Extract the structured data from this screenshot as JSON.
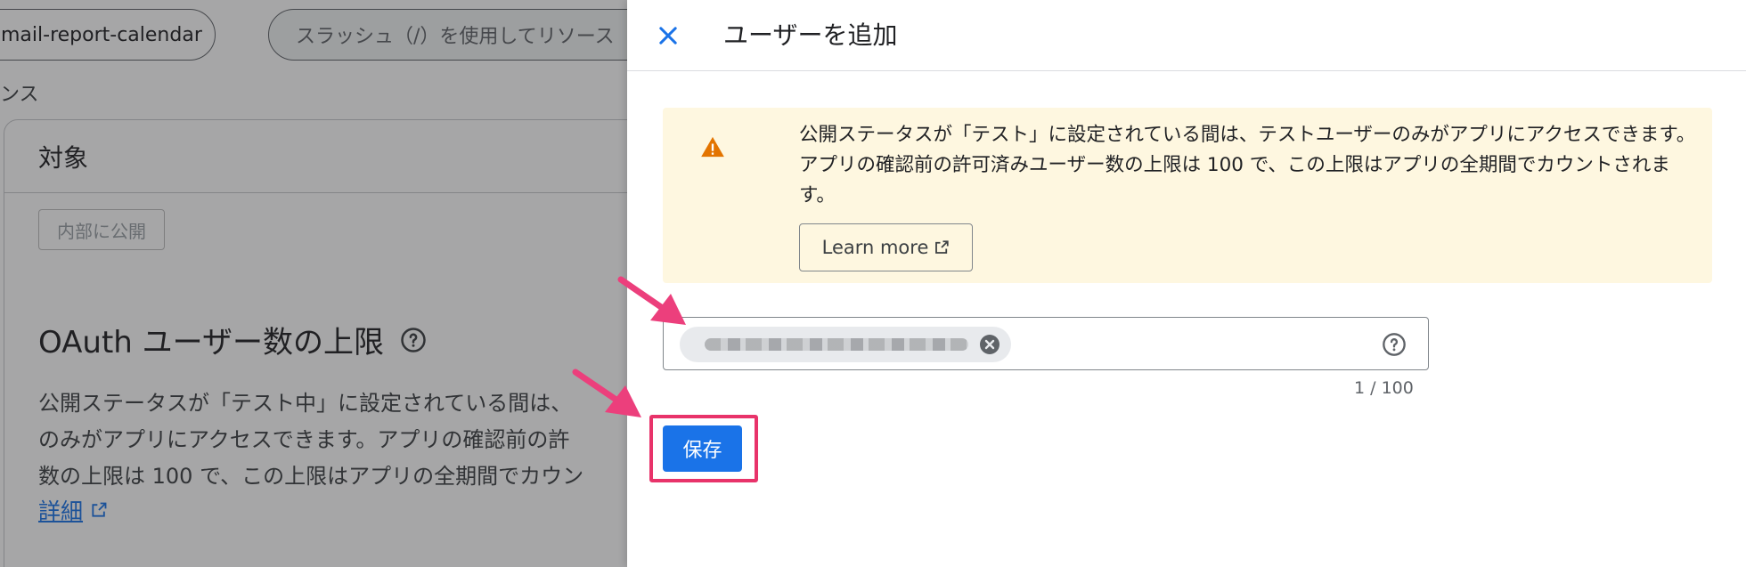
{
  "background": {
    "project_chip": "mail-report-calendar",
    "search_placeholder": "スラッシュ（/）を使用してリソース",
    "crumb": "ンス",
    "card_title": "対象",
    "badge": "内部に公開",
    "oauth_title": "OAuth ユーザー数の上限",
    "oauth_desc": "公開ステータスが「テスト中」に設定されている間は、\nのみがアプリにアクセスできます。アプリの確認前の許\n数の上限は 100 で、この上限はアプリの全期間でカウン",
    "detail_link": "詳細"
  },
  "panel": {
    "title": "ユーザーを追加",
    "warning": {
      "text": "公開ステータスが「テスト」に設定されている間は、テストユーザーのみがアプリにアクセスできます。アプリの確認前の許可済みユーザー数の上限は 100 で、この上限はアプリの全期間でカウントされます。",
      "learn_more": "Learn more"
    },
    "counter": "1 / 100",
    "save_label": "保存"
  },
  "colors": {
    "primary": "#1a73e8",
    "warning_bg": "#fef7e0",
    "warning_icon": "#e37400",
    "highlight": "#e8336a"
  },
  "icons": [
    "close-icon",
    "warning-icon",
    "external-link-icon",
    "remove-chip-icon",
    "help-icon"
  ]
}
